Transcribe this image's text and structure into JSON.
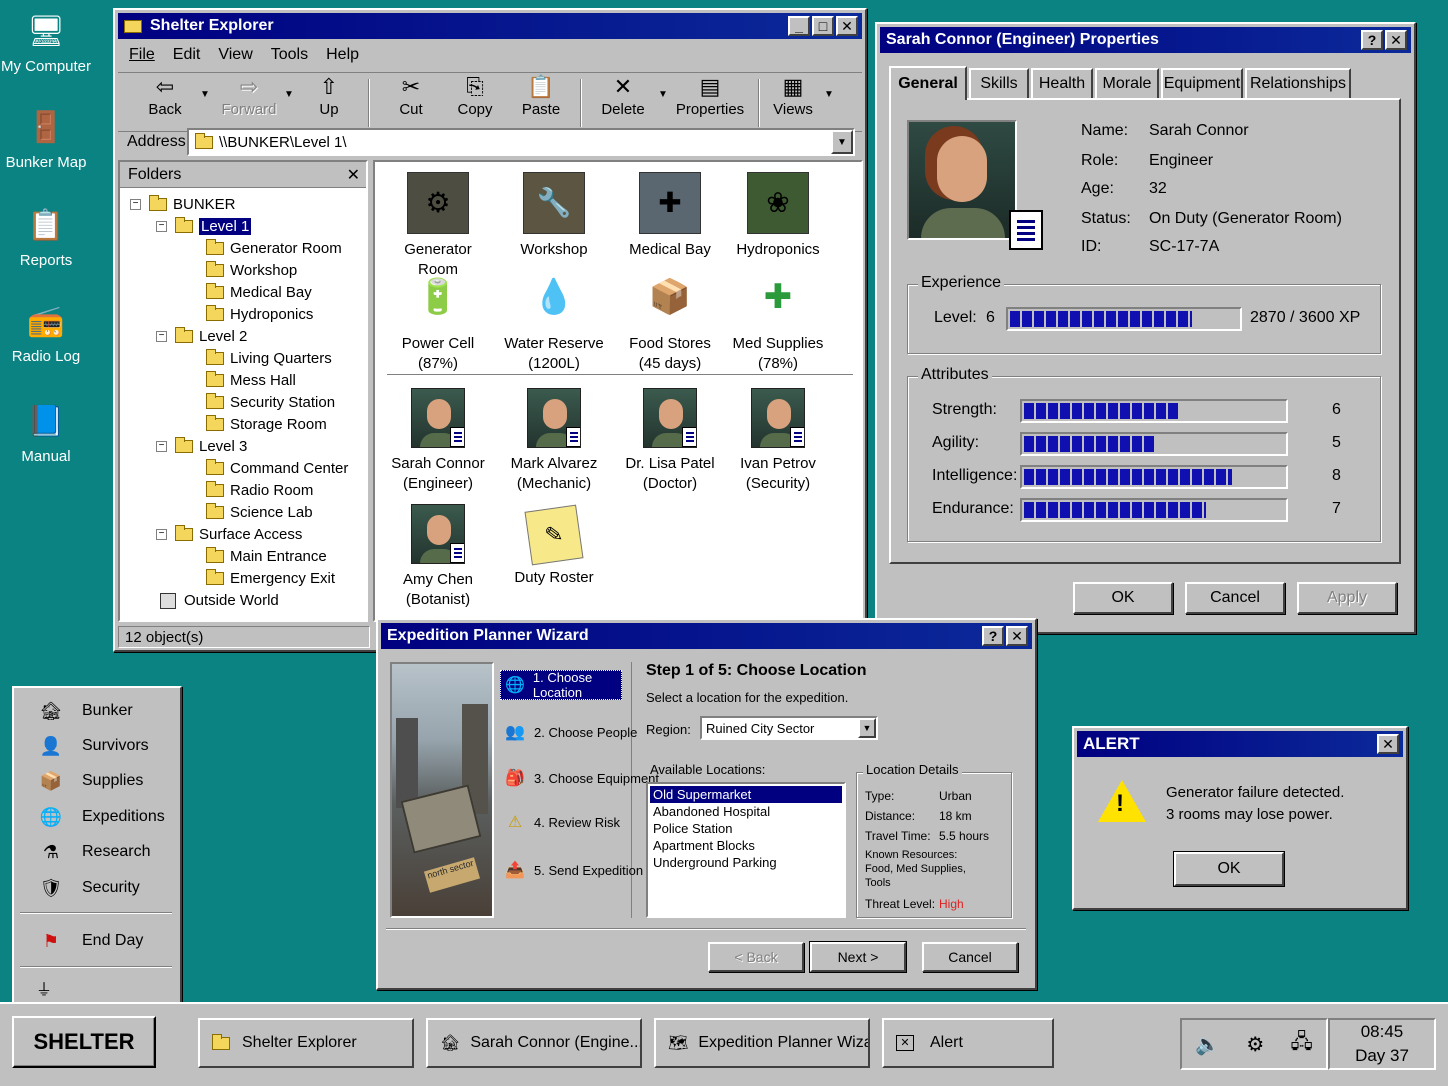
{
  "desktop": {
    "icons": [
      {
        "label": "My Computer",
        "icon": "computer-icon"
      },
      {
        "label": "Bunker Map",
        "icon": "bunker-door-icon"
      },
      {
        "label": "Reports",
        "icon": "clipboard-icon"
      },
      {
        "label": "Radio Log",
        "icon": "radio-icon"
      },
      {
        "label": "Manual",
        "icon": "book-icon"
      }
    ]
  },
  "explorer": {
    "title": "Shelter Explorer",
    "menu": [
      "File",
      "Edit",
      "View",
      "Tools",
      "Help"
    ],
    "toolbar": {
      "back": "Back",
      "forward": "Forward",
      "up": "Up",
      "cut": "Cut",
      "copy": "Copy",
      "paste": "Paste",
      "delete": "Delete",
      "properties": "Properties",
      "views": "Views"
    },
    "address_label": "Address",
    "address_value": "\\\\BUNKER\\Level 1\\",
    "folders_label": "Folders",
    "tree": {
      "root": "BUNKER",
      "level1": "Level 1",
      "gen": "Generator Room",
      "work": "Workshop",
      "med": "Medical Bay",
      "hyd": "Hydroponics",
      "level2": "Level 2",
      "living": "Living Quarters",
      "mess": "Mess Hall",
      "sec": "Security Station",
      "stor": "Storage Room",
      "level3": "Level 3",
      "cmd": "Command Center",
      "radio": "Radio Room",
      "sci": "Science Lab",
      "surface": "Surface Access",
      "main": "Main Entrance",
      "emerg": "Emergency Exit",
      "outside": "Outside World"
    },
    "items": {
      "rooms": [
        {
          "name": "Generator Room"
        },
        {
          "name": "Workshop"
        },
        {
          "name": "Medical Bay"
        },
        {
          "name": "Hydroponics"
        }
      ],
      "resources": [
        {
          "name": "Power Cell",
          "detail": "(87%)"
        },
        {
          "name": "Water Reserve",
          "detail": "(1200L)"
        },
        {
          "name": "Food Stores",
          "detail": "(45 days)"
        },
        {
          "name": "Med Supplies",
          "detail": "(78%)"
        }
      ],
      "people": [
        {
          "name": "Sarah Connor",
          "detail": "(Engineer)"
        },
        {
          "name": "Mark Alvarez",
          "detail": "(Mechanic)"
        },
        {
          "name": "Dr. Lisa Patel",
          "detail": "(Doctor)"
        },
        {
          "name": "Ivan Petrov",
          "detail": "(Security)"
        },
        {
          "name": "Amy Chen",
          "detail": "(Botanist)"
        }
      ],
      "roster": "Duty Roster"
    },
    "status": "12 object(s)"
  },
  "properties": {
    "title": "Sarah Connor (Engineer) Properties",
    "tabs": [
      "General",
      "Skills",
      "Health",
      "Morale",
      "Equipment",
      "Relationships"
    ],
    "fields": {
      "name_label": "Name:",
      "name": "Sarah Connor",
      "role_label": "Role:",
      "role": "Engineer",
      "age_label": "Age:",
      "age": "32",
      "status_label": "Status:",
      "status": "On Duty (Generator Room)",
      "id_label": "ID:",
      "id": "SC-17-7A"
    },
    "experience": {
      "label": "Experience",
      "level_label": "Level:",
      "level": "6",
      "xp_text": "2870 / 3600 XP",
      "fraction": 0.7972
    },
    "attributes": {
      "label": "Attributes",
      "items": [
        {
          "name": "Strength:",
          "value": "6",
          "fraction": 0.6
        },
        {
          "name": "Agility:",
          "value": "5",
          "fraction": 0.5
        },
        {
          "name": "Intelligence:",
          "value": "8",
          "fraction": 0.8
        },
        {
          "name": "Endurance:",
          "value": "7",
          "fraction": 0.7
        }
      ]
    },
    "buttons": {
      "ok": "OK",
      "cancel": "Cancel",
      "apply": "Apply"
    }
  },
  "wizard": {
    "title": "Expedition Planner Wizard",
    "steps": [
      "1. Choose Location",
      "2. Choose People",
      "3. Choose Equipment",
      "4. Review Risk",
      "5. Send Expedition"
    ],
    "heading": "Step 1 of 5:  Choose Location",
    "sub": "Select a location for the expedition.",
    "region_label": "Region:",
    "region_value": "Ruined City Sector",
    "locations_label": "Available Locations:",
    "locations": [
      "Old Supermarket",
      "Abandoned Hospital",
      "Police Station",
      "Apartment Blocks",
      "Underground Parking"
    ],
    "details_label": "Location Details",
    "details": {
      "type_label": "Type:",
      "type": "Urban",
      "dist_label": "Distance:",
      "dist": "18 km",
      "time_label": "Travel Time:",
      "time": "5.5 hours",
      "res_label": "Known Resources:",
      "res1": "Food, Med Supplies,",
      "res2": "Tools",
      "threat_label": "Threat Level:",
      "threat": "High"
    },
    "sign_text": "north sector",
    "buttons": {
      "back": "< Back",
      "next": "Next >",
      "cancel": "Cancel"
    }
  },
  "alert": {
    "title": "ALERT",
    "line1": "Generator failure detected.",
    "line2": "3 rooms may lose power.",
    "ok": "OK"
  },
  "sidemenu": {
    "items": [
      "Bunker",
      "Survivors",
      "Supplies",
      "Expeditions",
      "Research",
      "Security",
      "End Day"
    ]
  },
  "taskbar": {
    "start": "SHELTER",
    "tasks": [
      "Shelter Explorer",
      "Sarah Connor (Engine...",
      "Expedition Planner Wizard",
      "Alert"
    ],
    "time": "08:45",
    "day": "Day 37"
  },
  "colors": {
    "desktop": "#0b8382",
    "title": "#000080",
    "threat": "#e02020",
    "bar": "#1010b0"
  }
}
